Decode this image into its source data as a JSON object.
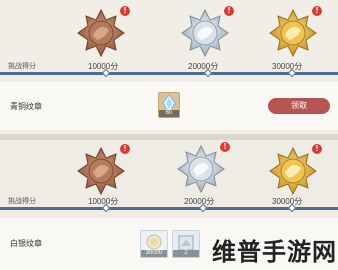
{
  "top_panel": {
    "score_label": "挑战得分",
    "badges": [
      {
        "name": "bronze",
        "score": "10000分",
        "alert": "!"
      },
      {
        "name": "silver",
        "score": "20000分",
        "alert": "!"
      },
      {
        "name": "gold",
        "score": "30000分",
        "alert": "!"
      }
    ],
    "reward": {
      "title": "青铜纹章",
      "item_count": "60",
      "claim_label": "领取"
    }
  },
  "bottom_panel": {
    "score_label": "挑战得分",
    "badges": [
      {
        "name": "bronze",
        "score": "10000分",
        "alert": "!"
      },
      {
        "name": "silver",
        "score": "20000分",
        "alert": "!"
      },
      {
        "name": "gold",
        "score": "30000分",
        "alert": "!"
      }
    ],
    "reward": {
      "title": "白银纹章",
      "item1_count": "30000",
      "item2_count": "2"
    }
  },
  "watermark": "维普手游网",
  "colors": {
    "bronze": "#a86e52",
    "silver": "#c9d4df",
    "gold": "#e3b84a",
    "track": "#4d6d8c",
    "claim_button": "#b45554",
    "alert": "#d63b34"
  }
}
